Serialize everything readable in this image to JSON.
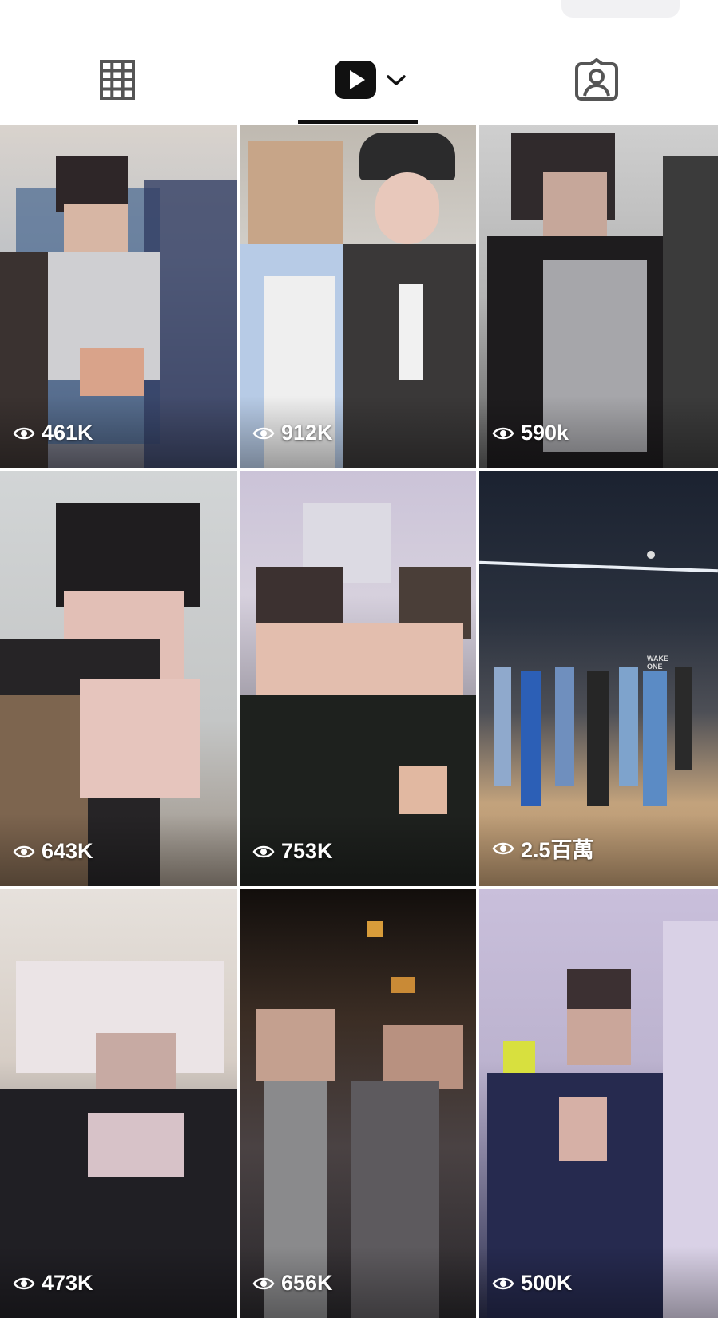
{
  "tabs": [
    {
      "name": "grid",
      "icon": "grid-icon"
    },
    {
      "name": "videos",
      "icon": "play-icon",
      "selected": true
    },
    {
      "name": "tagged",
      "icon": "tagged-user-icon"
    }
  ],
  "tiles": [
    {
      "views": "461K"
    },
    {
      "views": "912K"
    },
    {
      "views": "590k"
    },
    {
      "views": "643K"
    },
    {
      "views": "753K"
    },
    {
      "views": "2.5百萬"
    },
    {
      "views": "473K"
    },
    {
      "views": "656K"
    },
    {
      "views": "500K"
    }
  ],
  "colors": {
    "accent": "#111111",
    "icon_gray": "#555555",
    "background": "#ffffff"
  }
}
